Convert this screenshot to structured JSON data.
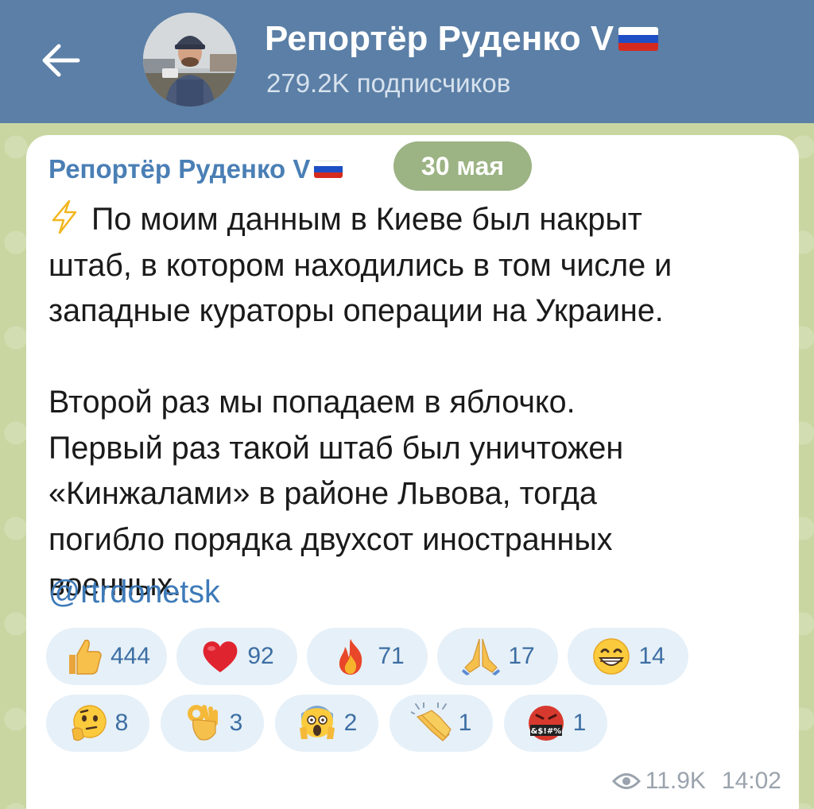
{
  "header": {
    "back_label": "←",
    "channel_name": "Репортёр Руденко V",
    "subscribers": "279.2K подписчиков"
  },
  "post": {
    "author": "Репортёр Руденко V",
    "date": "30 мая",
    "paragraph1": "По моим данным в Киеве был накрыт\nштаб, в котором находились в том числе и\nзападные кураторы операции на Украине.",
    "paragraph2": "Второй раз мы попадаем в яблочко.\nПервый раз такой штаб был уничтожен\n«Кинжалами» в районе Львова, тогда\nпогибло порядка двухсот иностранных\nвоенных.",
    "link": "@rtrdonetsk",
    "views": "11.9K",
    "time": "14:02"
  },
  "reactions": [
    {
      "icon": "thumbs-up-icon",
      "count": "444"
    },
    {
      "icon": "red-heart-icon",
      "count": "92"
    },
    {
      "icon": "fire-icon",
      "count": "71"
    },
    {
      "icon": "folded-hands-icon",
      "count": "17"
    },
    {
      "icon": "grinning-face-icon",
      "count": "14"
    },
    {
      "icon": "thinking-face-icon",
      "count": "8"
    },
    {
      "icon": "ok-hand-icon",
      "count": "3"
    },
    {
      "icon": "screaming-face-icon",
      "count": "2"
    },
    {
      "icon": "clapping-hands-icon",
      "count": "1"
    },
    {
      "icon": "swearing-face-icon",
      "count": "1",
      "text": "&$!#%"
    }
  ],
  "colors": {
    "header_bg": "#5b7fa6",
    "accent": "#4a7fb5",
    "date_pill": "#9cb384",
    "reaction_bg": "#e6f0f8"
  }
}
